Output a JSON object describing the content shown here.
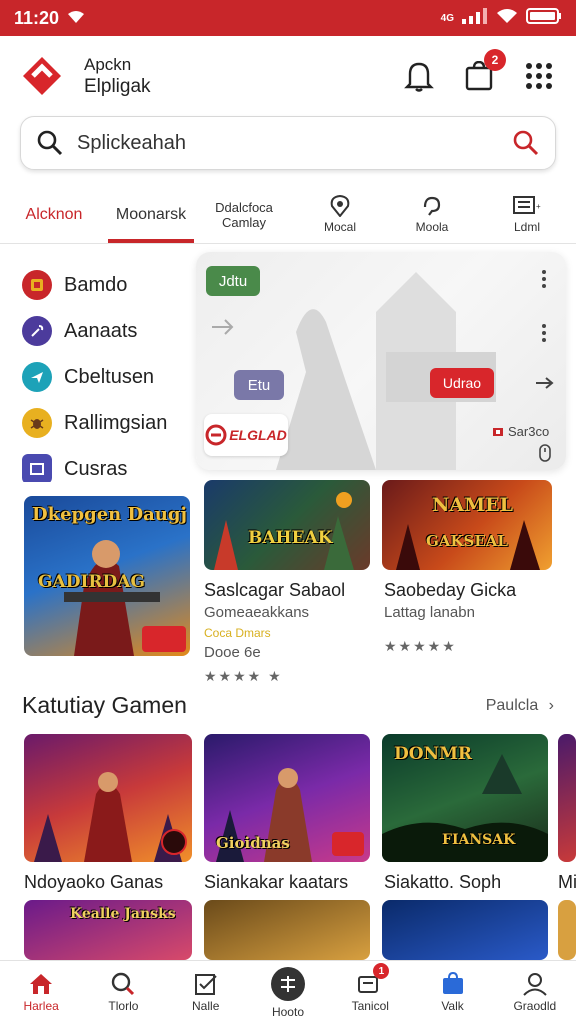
{
  "status_bar": {
    "time": "11:20",
    "network": "4G"
  },
  "header": {
    "brand_line1": "Apckn",
    "brand_line2": "Elpligak",
    "notification_badge": "2"
  },
  "search": {
    "placeholder": "Splickeahah"
  },
  "tabs": [
    {
      "label": "Alcknon",
      "icon": "",
      "active": true
    },
    {
      "label": "Moonarsk",
      "icon": "",
      "underlined": true
    },
    {
      "label": "Ddalcfoca Camlay",
      "icon": ""
    },
    {
      "label": "Mocal",
      "icon": "location-pin-icon"
    },
    {
      "label": "Moola",
      "icon": "refresh-icon"
    },
    {
      "label": "Ldml",
      "icon": "list-box-icon"
    }
  ],
  "sidebar": {
    "items": [
      {
        "label": "Bamdo",
        "icon": "shop-icon",
        "color": "#c8262a"
      },
      {
        "label": "Aanaats",
        "icon": "wrench-icon",
        "color": "#4c3b9c"
      },
      {
        "label": "Cbeltusen",
        "icon": "plane-icon",
        "color": "#1da2b8"
      },
      {
        "label": "Rallimgsian",
        "icon": "bug-icon",
        "color": "#e8b020"
      },
      {
        "label": "Cusras",
        "icon": "tv-icon",
        "color": "#4a4ab0"
      }
    ]
  },
  "overlay_card": {
    "chip_top": "Jdtu",
    "chip_mid": "Etu",
    "chip_cta": "Udrao",
    "brand_label": "ELGLAD",
    "info_text": "Sar3co"
  },
  "featured": {
    "poster_title": "Dkepgen Daugj",
    "poster_subtitle": "GADIRDAG",
    "tile1": {
      "art_title": "BAHEAK",
      "title": "Saslcagar Sabaol",
      "subtitle": "Gomeaeakkans",
      "tag": "Coca Dmars",
      "price": "Dooe 6e",
      "stars": "★★★★ ★"
    },
    "tile2": {
      "art_title": "NAMEL",
      "art_subtitle": "GAKSEAL",
      "title": "Saobeday Gicka",
      "subtitle": "Lattag lanabn",
      "stars": "★★★★★"
    }
  },
  "section": {
    "title": "Katutiay Gamen",
    "see_all": "Paulcla"
  },
  "games": [
    {
      "title": "Ndoyaoko Ganas",
      "art_title": "Kealle Jansks"
    },
    {
      "title": "Siankakar kaatars",
      "art_title": "Gioidnas"
    },
    {
      "title": "Siakatto. Soph",
      "art_title": "DONMR",
      "art_subtitle": "FIANSAK"
    },
    {
      "title": "Mi",
      "art_title": ""
    }
  ],
  "bottom_nav": [
    {
      "label": "Harlea",
      "icon": "home-icon",
      "active": true
    },
    {
      "label": "Tlorlo",
      "icon": "search-icon"
    },
    {
      "label": "Nalle",
      "icon": "checklist-icon"
    },
    {
      "label": "Hooto",
      "icon": "controller-icon"
    },
    {
      "label": "Tanicol",
      "icon": "chat-icon",
      "badge": "1"
    },
    {
      "label": "Valk",
      "icon": "bag-icon"
    },
    {
      "label": "Graodld",
      "icon": "person-icon"
    }
  ],
  "colors": {
    "accent": "#c8262a",
    "chip_green": "#4a8a4a",
    "chip_purple": "#7a78a8"
  }
}
